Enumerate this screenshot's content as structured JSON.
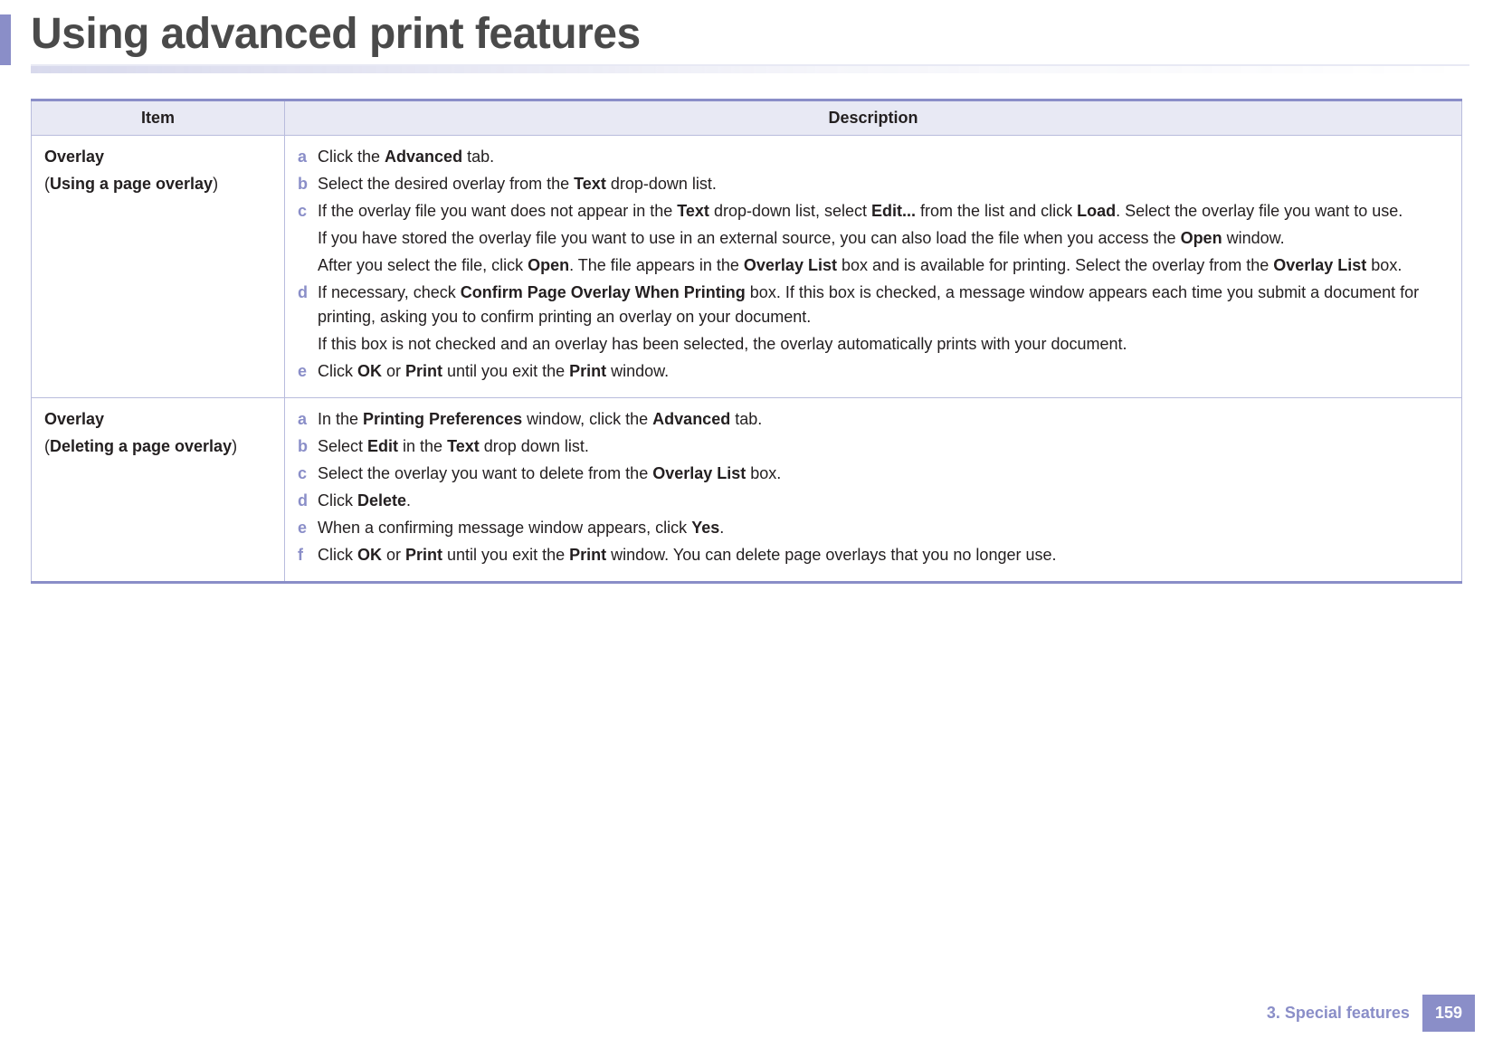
{
  "header": {
    "title": "Using advanced print features"
  },
  "table": {
    "columns": {
      "item": "Item",
      "description": "Description"
    },
    "rows": [
      {
        "item_title": "Overlay",
        "item_sub_inner": "Using a page overlay",
        "steps": {
          "a": {
            "text": "Click the ",
            "b1": "Advanced",
            "after1": " tab."
          },
          "b": {
            "text": "Select the desired overlay from the ",
            "b1": "Text",
            "after1": " drop-down list."
          },
          "c": {
            "text": "If the overlay file you want does not appear in the ",
            "b1": "Text",
            "after1": " drop-down list, select ",
            "b2": "Edit...",
            "after2": " from the list and click ",
            "b3": "Load",
            "after3": ". Select the overlay file you want to use.",
            "follow1_pre": "If you have stored the overlay file you want to use in an external source, you can also load the file when you access the ",
            "follow1_b": "Open",
            "follow1_post": " window.",
            "follow2_pre": "After you select the file, click ",
            "follow2_b1": "Open",
            "follow2_mid1": ". The file appears in the ",
            "follow2_b2": "Overlay List",
            "follow2_mid2": " box and is available for printing. Select the overlay from the ",
            "follow2_b3": "Overlay List",
            "follow2_post": " box."
          },
          "d": {
            "text": "If necessary, check ",
            "b1": "Confirm Page Overlay When Printing",
            "after1": " box. If this box is checked, a message window appears each time you submit a document for printing, asking you to confirm printing an overlay on your document.",
            "follow1": "If this box is not checked and an overlay has been selected, the overlay automatically prints with your document."
          },
          "e": {
            "text": "Click ",
            "b1": "OK",
            "mid1": " or ",
            "b2": "Print",
            "mid2": " until you exit the ",
            "b3": "Print",
            "after": " window."
          }
        }
      },
      {
        "item_title": "Overlay",
        "item_sub_inner": "Deleting a page overlay",
        "steps": {
          "a": {
            "text": "In the ",
            "b1": "Printing Preferences",
            "mid1": " window, click the ",
            "b2": "Advanced",
            "after": " tab."
          },
          "b": {
            "text": "Select ",
            "b1": "Edit",
            "mid1": " in the ",
            "b2": "Text",
            "after": " drop down list."
          },
          "c": {
            "text": "Select the overlay you want to delete from the ",
            "b1": "Overlay List",
            "after": " box."
          },
          "d": {
            "text": "Click ",
            "b1": "Delete",
            "after": "."
          },
          "e": {
            "text": "When a confirming message window appears, click ",
            "b1": "Yes",
            "after": "."
          },
          "f": {
            "text": "Click ",
            "b1": "OK",
            "mid1": " or ",
            "b2": "Print",
            "mid2": " until you exit the ",
            "b3": "Print",
            "after": " window. You can delete page overlays that you no longer use."
          }
        }
      }
    ]
  },
  "footer": {
    "chapter": "3.  Special features",
    "page": "159"
  },
  "markers": {
    "a": "a",
    "b": "b",
    "c": "c",
    "d": "d",
    "e": "e",
    "f": "f"
  },
  "paren": {
    "open": "(",
    "close": ")"
  }
}
